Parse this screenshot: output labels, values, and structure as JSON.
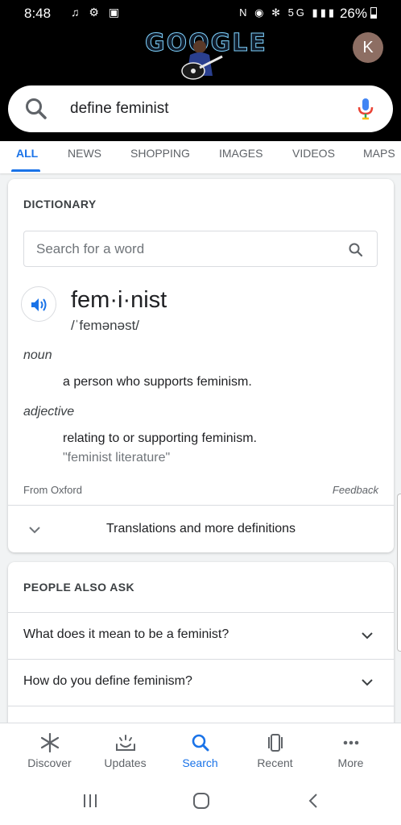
{
  "status_bar": {
    "time": "8:48",
    "network": "5G",
    "battery": "26%"
  },
  "doodle": {
    "text": "GOOGLE"
  },
  "account": {
    "initial": "K"
  },
  "search": {
    "query": "define feminist"
  },
  "tabs": [
    {
      "label": "ALL",
      "active": true
    },
    {
      "label": "NEWS"
    },
    {
      "label": "SHOPPING"
    },
    {
      "label": "IMAGES"
    },
    {
      "label": "VIDEOS"
    },
    {
      "label": "MAPS"
    }
  ],
  "dictionary": {
    "title": "DICTIONARY",
    "search_placeholder": "Search for a word",
    "headword": "fem·i·nist",
    "phonetic": "/ˈfemənəst/",
    "senses": [
      {
        "pos": "noun",
        "definition": "a person who supports feminism."
      },
      {
        "pos": "adjective",
        "definition": "relating to or supporting feminism.",
        "example": "\"feminist literature\""
      }
    ],
    "source": "From Oxford",
    "feedback": "Feedback",
    "more_label": "Translations and more definitions"
  },
  "people_also_ask": {
    "title": "PEOPLE ALSO ASK",
    "questions": [
      "What does it mean to be a feminist?",
      "How do you define feminism?"
    ]
  },
  "bottom_nav": [
    {
      "label": "Discover",
      "icon": "asterisk-icon"
    },
    {
      "label": "Updates",
      "icon": "updates-icon"
    },
    {
      "label": "Search",
      "icon": "search-icon",
      "active": true
    },
    {
      "label": "Recent",
      "icon": "recent-icon"
    },
    {
      "label": "More",
      "icon": "more-dots-icon"
    }
  ],
  "colors": {
    "accent": "#1a73e8",
    "top_bg": "#000000",
    "avatar": "#8d6e63"
  }
}
